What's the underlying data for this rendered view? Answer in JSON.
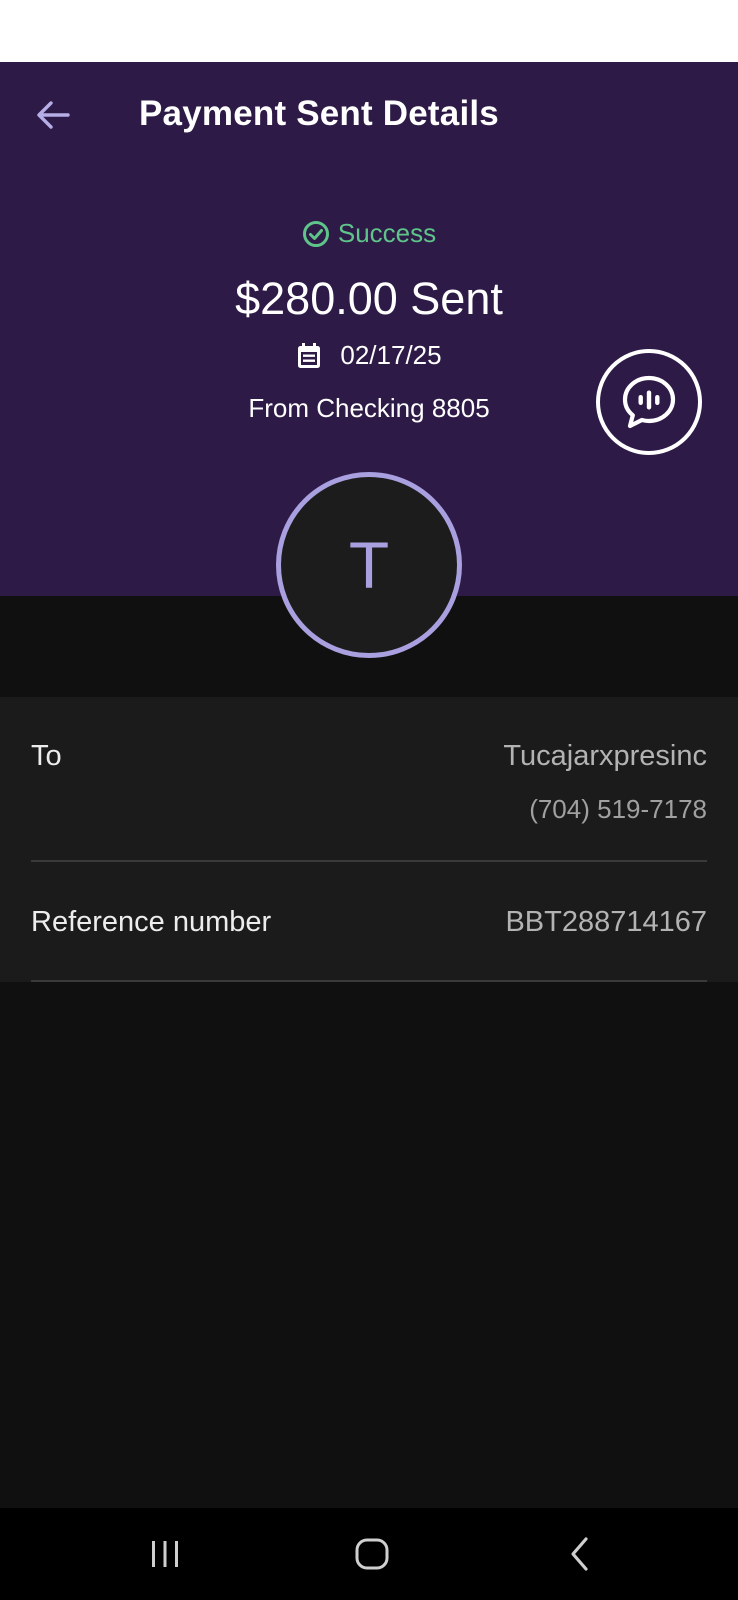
{
  "header": {
    "title": "Payment Sent Details",
    "back_icon": "arrow-left-icon"
  },
  "payment": {
    "status": "Success",
    "status_color": "#5fc48a",
    "amount_text": "$280.00 Sent",
    "date": "02/17/25",
    "from": "From Checking 8805"
  },
  "recipient_avatar": {
    "initial": "T"
  },
  "chat": {
    "icon": "chat-bubble-icon"
  },
  "details": {
    "to_label": "To",
    "to_name": "Tucajarxpresinc",
    "to_phone": "(704) 519-7178",
    "reference_label": "Reference number",
    "reference_value": "BBT288714167"
  },
  "colors": {
    "header_bg": "#2e1a47",
    "accent": "#a9a0e0",
    "success": "#5fc48a"
  },
  "nav": {
    "recents_icon": "recents-icon",
    "home_icon": "home-icon",
    "back_icon": "nav-back-icon"
  }
}
